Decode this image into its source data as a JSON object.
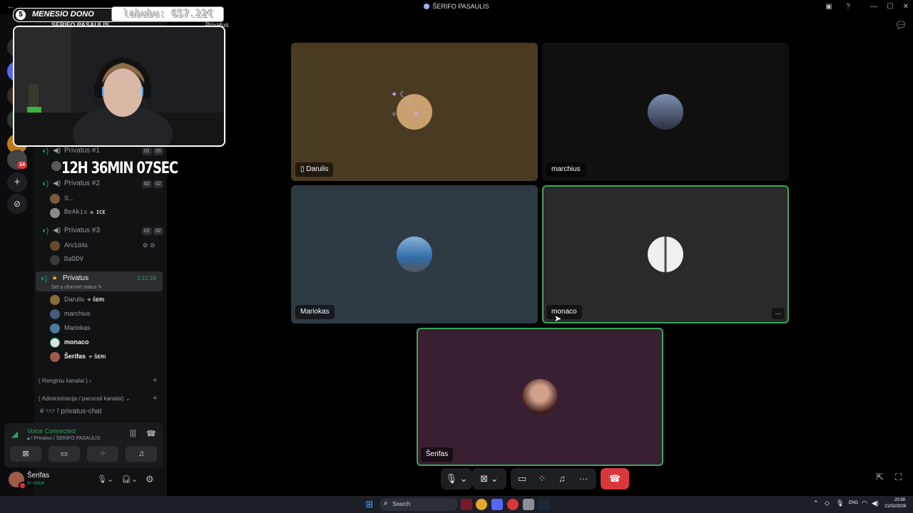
{
  "window": {
    "title": "ŠERIFO PASAULIS",
    "back_glyph": "←"
  },
  "overlay": {
    "dono_label": "MENESIO DONO",
    "dono_value": "labubu: 657.22€",
    "timer": "12H 36MIN 07SEC"
  },
  "server_header": {
    "name": "ŠERIFO PASAULIS",
    "channel": "Privatus"
  },
  "rail": {
    "badge_count": "14",
    "add_glyph": "+",
    "discover_glyph": "⊘"
  },
  "channels": [
    {
      "name": "Privatus #1",
      "count_a": "01",
      "count_b": "05"
    },
    {
      "name": "Privatus #2",
      "count_a": "02",
      "count_b": "02"
    },
    {
      "name": "Privatus #3",
      "count_a": "02",
      "count_b": "02"
    },
    {
      "name": "Privatus",
      "duration": "3:12:18",
      "status_hint": "Set a channel status"
    }
  ],
  "channel2_members": [
    {
      "name": "S...",
      "tag": ""
    },
    {
      "name": "BeAkis",
      "tag": "ICE"
    }
  ],
  "channel3_members": [
    {
      "name": "Arv1d4s",
      "tag": ""
    },
    {
      "name": "DaDDV",
      "tag": ""
    }
  ],
  "private_members": [
    {
      "name": "Darulis",
      "tag": "ŠERI",
      "bold": false
    },
    {
      "name": "marchius",
      "tag": "",
      "bold": false
    },
    {
      "name": "Mariokas",
      "tag": "",
      "bold": false
    },
    {
      "name": "monaco",
      "tag": "",
      "bold": true
    },
    {
      "name": "Šerifas",
      "tag": "ŠERI",
      "bold": true
    }
  ],
  "categories": {
    "events": "( Renginiu kanalai )",
    "admin": "( Administracija / paruosti kanalai)",
    "text_channel": "! privatus-chat"
  },
  "voice": {
    "status": "Voice Connected",
    "location": "! Privatus / ŠERIFO PASAULIS"
  },
  "user": {
    "name": "Šerifas",
    "status": "In voice"
  },
  "tiles": [
    {
      "name": "Darulis",
      "bg": "#4a3a21",
      "speaking": false,
      "mobile": true
    },
    {
      "name": "marchius",
      "bg": "#101010",
      "speaking": false,
      "mobile": false
    },
    {
      "name": "Mariokas",
      "bg": "#2e3b44",
      "speaking": false,
      "mobile": false
    },
    {
      "name": "monaco",
      "bg": "#2a2a2a",
      "speaking": true,
      "mobile": false
    },
    {
      "name": "Šerifas",
      "bg": "#3a1f30",
      "speaking": true,
      "mobile": false
    }
  ],
  "controls": {
    "more_glyph": "···",
    "tile_more_glyph": "···"
  },
  "taskbar": {
    "search_label": "Search",
    "lang": "ENG",
    "time": "20:58",
    "date": "21/02/2026"
  },
  "colors": {
    "accent_green": "#23a55a",
    "leave_red": "#da373c",
    "speaking_outline": "#3ba55c"
  }
}
